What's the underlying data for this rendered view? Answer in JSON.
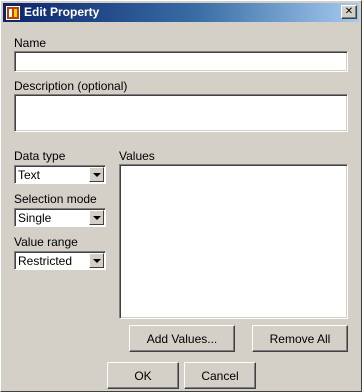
{
  "window": {
    "title": "Edit Property",
    "close_glyph": "✕",
    "icon": "app-icon"
  },
  "form": {
    "name_label": "Name",
    "name_value": "",
    "description_label": "Description (optional)",
    "description_value": "",
    "data_type_label": "Data type",
    "data_type_value": "Text",
    "selection_mode_label": "Selection mode",
    "selection_mode_value": "Single",
    "value_range_label": "Value range",
    "value_range_value": "Restricted",
    "values_label": "Values"
  },
  "buttons": {
    "add_values": "Add Values...",
    "remove_all": "Remove All",
    "ok": "OK",
    "cancel": "Cancel"
  },
  "colors": {
    "window_bg": "#d4d0c8",
    "title_start": "#0a246a",
    "title_end": "#a6caf0"
  }
}
